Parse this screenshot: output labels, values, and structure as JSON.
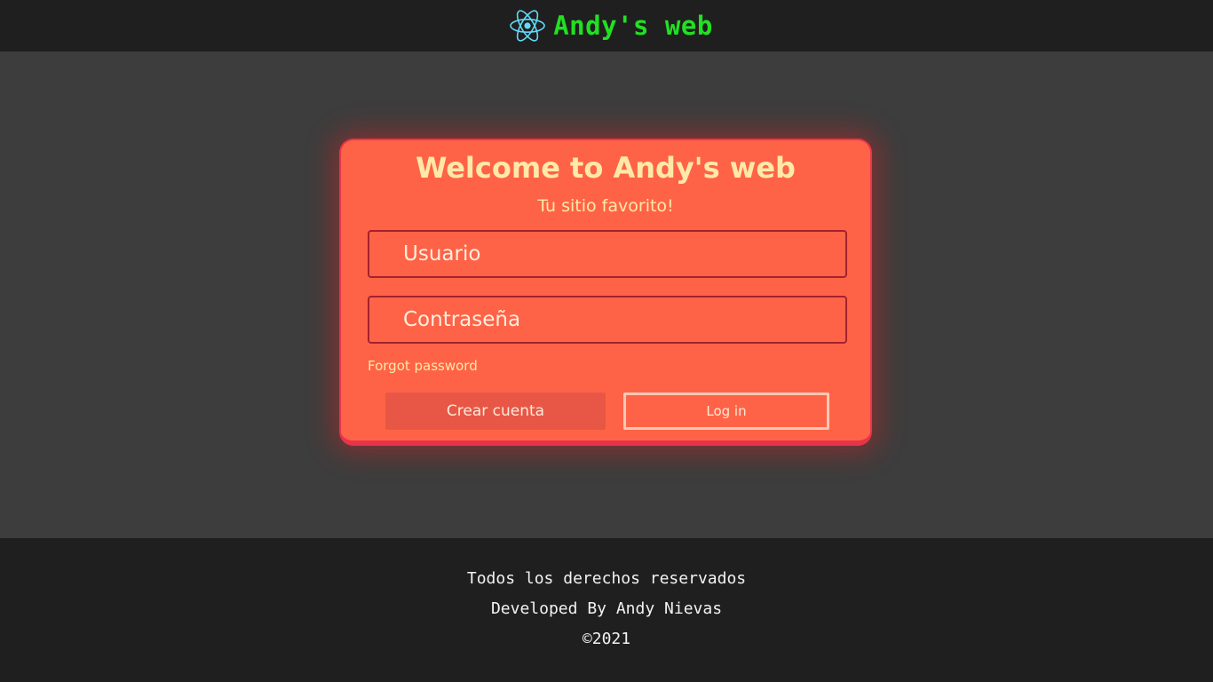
{
  "header": {
    "logo_icon": "react-atom-icon",
    "brand_title": "Andy's web",
    "brand_color": "#22e022",
    "icon_color": "#61dafb"
  },
  "login_card": {
    "title": "Welcome to Andy's web",
    "subtitle": "Tu sitio favorito!",
    "username_placeholder": "Usuario",
    "password_placeholder": "Contraseña",
    "forgot_password": "Forgot password",
    "create_account_label": "Crear cuenta",
    "login_label": "Log in",
    "card_color": "#ff6347",
    "text_accent_color": "#ffe9a8"
  },
  "footer": {
    "rights": "Todos los derechos reservados",
    "developer": "Developed By Andy Nievas",
    "copyright": "©2021"
  }
}
